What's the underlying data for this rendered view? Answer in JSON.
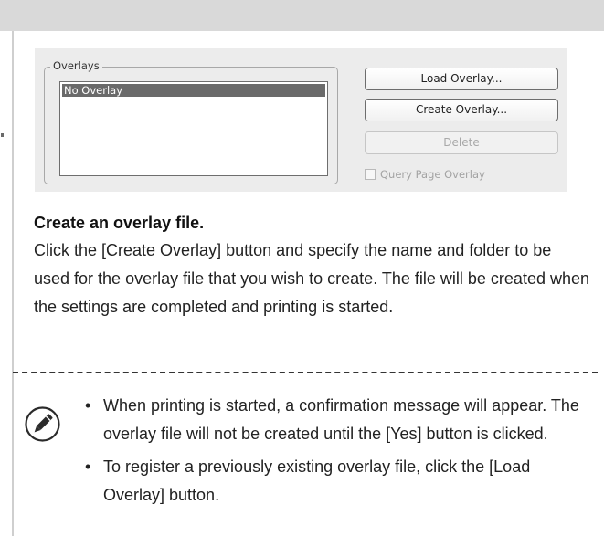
{
  "dialog": {
    "group_title": "Overlays",
    "list_items": [
      "No Overlay"
    ],
    "selected_index": 0,
    "buttons": {
      "load": "Load Overlay...",
      "create": "Create Overlay...",
      "delete": "Delete"
    },
    "checkbox": {
      "label": "Query Page Overlay",
      "checked": false,
      "enabled": false
    }
  },
  "step": {
    "heading": "Create an overlay file.",
    "body": "Click the [Create Overlay] button and specify the name and folder to be used for the overlay file that you wish to create. The file will be created when the settings are completed and printing is started."
  },
  "notes": {
    "icon": "pencil-icon",
    "bullet_symbol": "•",
    "items": [
      "When printing is started, a confirmation message will appear. The overlay file will not be created until the [Yes] button is clicked.",
      "To register a previously existing overlay file, click the [Load Overlay] button."
    ]
  },
  "colors": {
    "top_band": "#d9d9d9",
    "dialog_bg": "#ececec",
    "selection": "#6a6a6a",
    "disabled_text": "#a8a8a8"
  }
}
